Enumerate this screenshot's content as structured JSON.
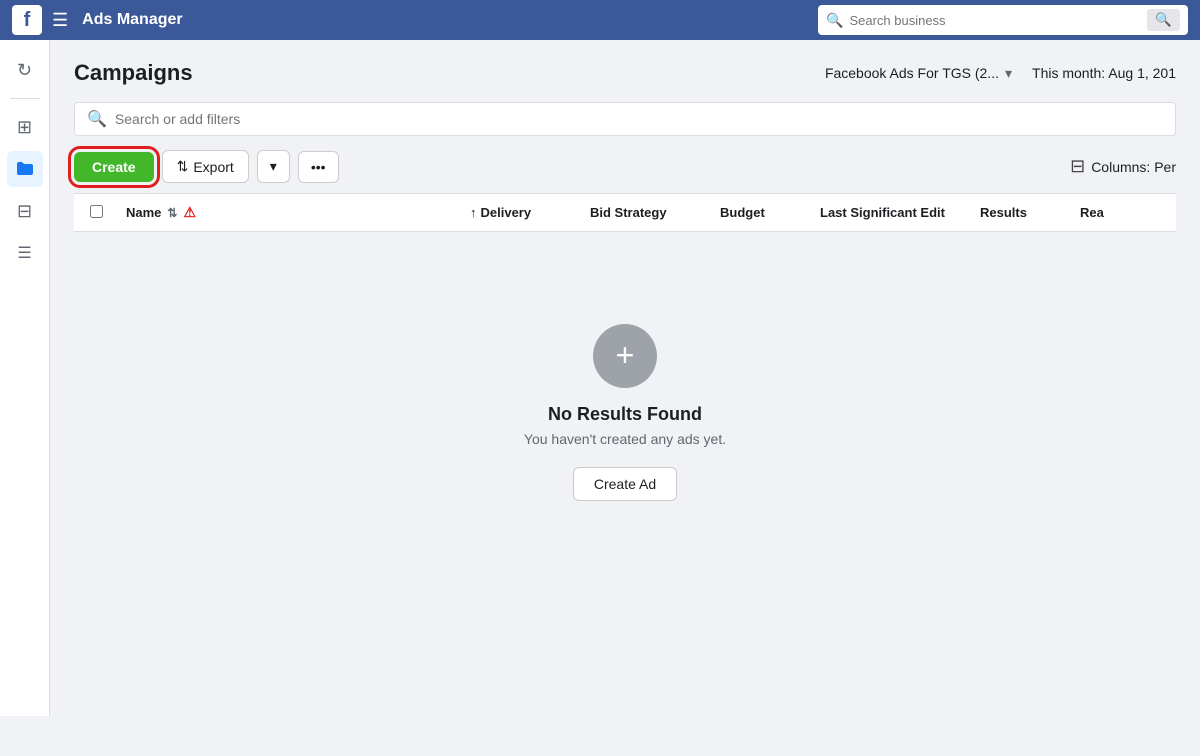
{
  "topnav": {
    "logo": "f",
    "menu_label": "☰",
    "title": "Ads Manager",
    "search_placeholder": "Search business"
  },
  "sidebar": {
    "items": [
      {
        "id": "refresh",
        "icon": "↻",
        "active": false
      },
      {
        "id": "divider1"
      },
      {
        "id": "grid",
        "icon": "⊞",
        "active": false
      },
      {
        "id": "folder",
        "icon": "📁",
        "active": true
      },
      {
        "id": "apps",
        "icon": "⊟",
        "active": false
      },
      {
        "id": "doc",
        "icon": "☰",
        "active": false
      }
    ]
  },
  "page": {
    "title": "Campaigns",
    "account_name": "Facebook Ads For TGS (2...",
    "date_range": "This month: Aug 1, 201"
  },
  "filter": {
    "placeholder": "Search or add filters"
  },
  "toolbar": {
    "create_label": "Create",
    "export_label": "Export",
    "dropdown_icon": "▾",
    "more_icon": "•••",
    "columns_label": "Columns: Per"
  },
  "table": {
    "columns": [
      {
        "id": "name",
        "label": "Name"
      },
      {
        "id": "delivery",
        "label": "Delivery"
      },
      {
        "id": "bid_strategy",
        "label": "Bid Strategy"
      },
      {
        "id": "budget",
        "label": "Budget"
      },
      {
        "id": "last_significant_edit",
        "label": "Last Significant Edit"
      },
      {
        "id": "results",
        "label": "Results"
      },
      {
        "id": "reach",
        "label": "Rea"
      }
    ]
  },
  "empty_state": {
    "icon": "+",
    "title": "No Results Found",
    "subtitle": "You haven't created any ads yet.",
    "create_ad_label": "Create Ad"
  }
}
